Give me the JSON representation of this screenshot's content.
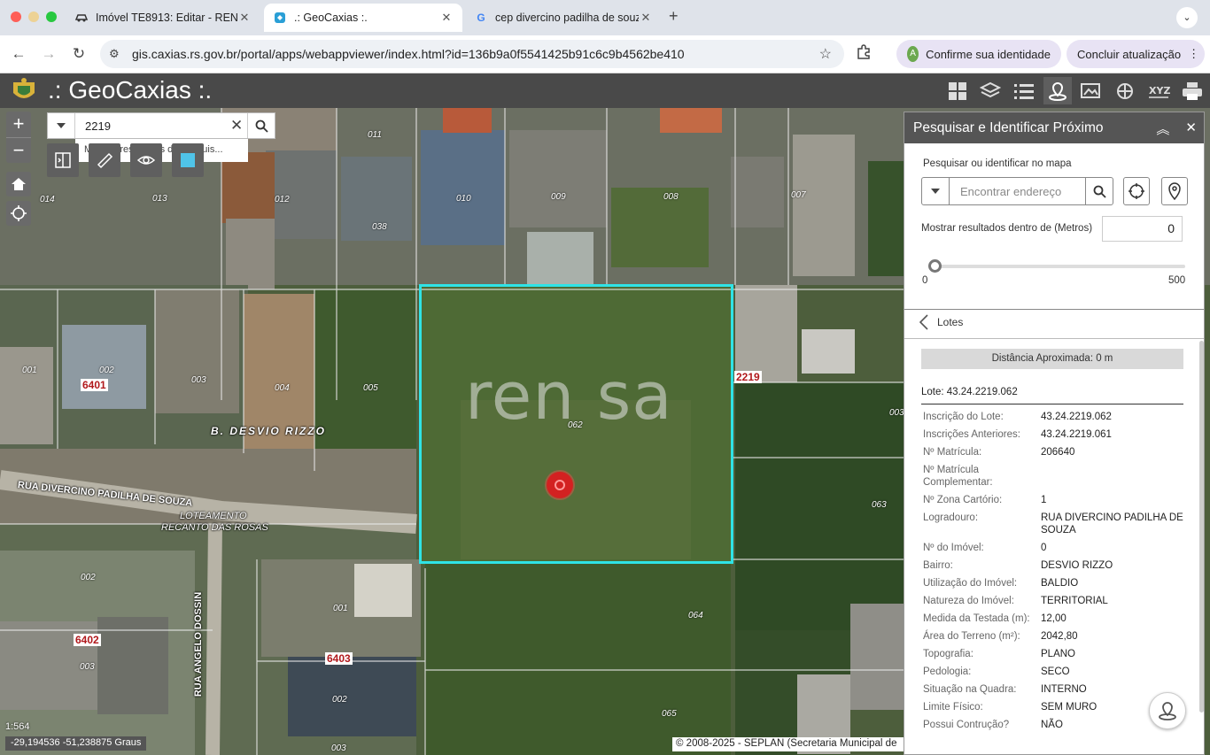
{
  "browser": {
    "tabs": [
      {
        "label": "Imóvel TE8913: Editar - RENA",
        "icon": "car-icon"
      },
      {
        "label": ".: GeoCaxias :.",
        "icon": "geo-icon"
      },
      {
        "label": "cep divercino padilha de souz",
        "icon": "google-icon"
      }
    ],
    "url": "gis.caxias.rs.gov.br/portal/apps/webappviewer/index.html?id=136b9a0f5541425b91c6c9b4562be410",
    "identity_label": "Confirme sua identidade",
    "identity_avatar": "A",
    "update_label": "Concluir atualização"
  },
  "app": {
    "title": ".: GeoCaxias :.",
    "header_icons": [
      "grid-icon",
      "layers-icon",
      "list-icon",
      "search-nearby-icon",
      "gallery-icon",
      "tools-icon",
      "xyz-icon",
      "print-icon"
    ],
    "accent": "#2fe3e6"
  },
  "map": {
    "search_value": "2219",
    "suggestion": "Mostrar resultados da pesquis...",
    "lots": [
      "011",
      "013",
      "012",
      "010",
      "009",
      "008",
      "007",
      "014",
      "038",
      "001",
      "002",
      "003",
      "004",
      "005",
      "062",
      "003",
      "063",
      "002",
      "001",
      "064",
      "003",
      "002",
      "065",
      "003"
    ],
    "blocks": [
      "6401",
      "2219",
      "6402",
      "6403"
    ],
    "streets": {
      "bairro": "B. DESVIO RIZZO",
      "rua_divercino": "RUA DIVERCINO PADILHA DE SOUZA",
      "loteamento_1": "LOTEAMENTO",
      "loteamento_2": "RECANTO DAS ROSAS",
      "rua_angelo": "RUA ANGELO DOSSIN"
    },
    "watermark": "ren sa",
    "scale": "1:564",
    "coords": "-29,194536 -51,238875 Graus",
    "attribution": "© 2008-2025 - SEPLAN (Secretaria Municipal de"
  },
  "panel": {
    "title": "Pesquisar e Identificar Próximo",
    "search_label": "Pesquisar ou identificar no mapa",
    "address_placeholder": "Encontrar endereço",
    "distance_label": "Mostrar resultados dentro de (Metros)",
    "distance_value": "0",
    "slider_min": "0",
    "slider_max": "500",
    "slider_fraction": 0,
    "back_label": "Lotes",
    "distance_bar": "Distância Aproximada: 0 m",
    "lot_title": "Lote: 43.24.2219.062",
    "attributes": [
      {
        "k": "Inscrição do Lote:",
        "v": "43.24.2219.062"
      },
      {
        "k": "Inscrições Anteriores:",
        "v": "43.24.2219.061"
      },
      {
        "k": "Nº Matrícula:",
        "v": "206640"
      },
      {
        "k": "Nº Matrícula Complementar:",
        "v": ""
      },
      {
        "k": "Nº Zona Cartório:",
        "v": "1"
      },
      {
        "k": "Logradouro:",
        "v": "RUA DIVERCINO PADILHA DE SOUZA"
      },
      {
        "k": "Nº do Imóvel:",
        "v": "0"
      },
      {
        "k": "Bairro:",
        "v": "DESVIO RIZZO"
      },
      {
        "k": "Utilização do Imóvel:",
        "v": "BALDIO"
      },
      {
        "k": "Natureza do Imóvel:",
        "v": "TERRITORIAL"
      },
      {
        "k": "Medida da Testada (m):",
        "v": "12,00"
      },
      {
        "k": "Área do Terreno (m²):",
        "v": "2042,80"
      },
      {
        "k": "Topografia:",
        "v": "PLANO"
      },
      {
        "k": "Pedologia:",
        "v": "SECO"
      },
      {
        "k": "Situação na Quadra:",
        "v": "INTERNO"
      },
      {
        "k": "Limite Físico:",
        "v": "SEM MURO"
      },
      {
        "k": "Possui Contrução?",
        "v": "NÃO"
      }
    ]
  }
}
